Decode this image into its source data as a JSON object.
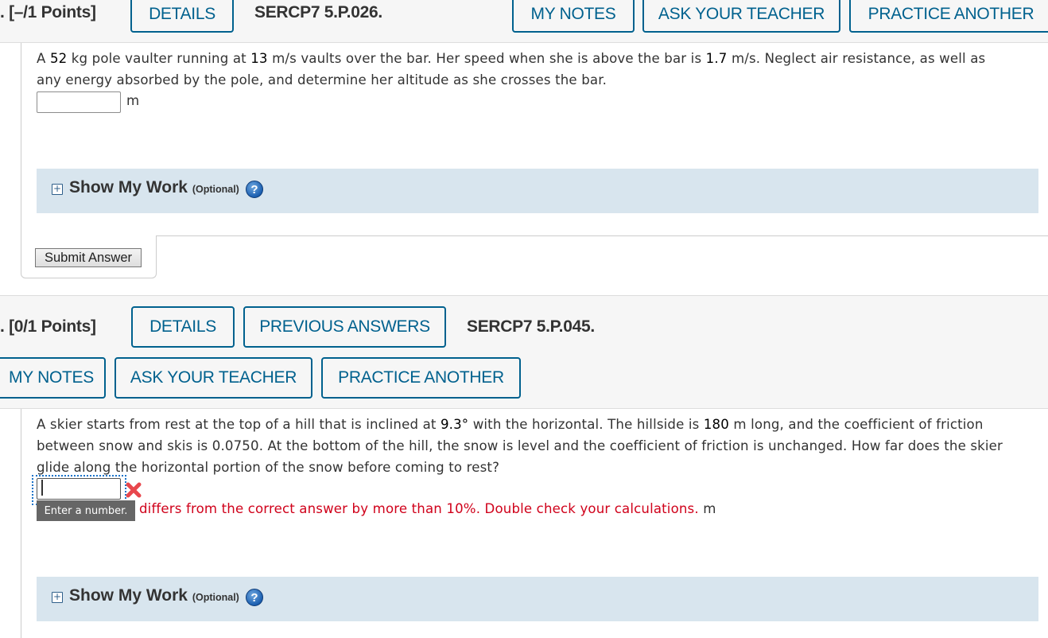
{
  "question1": {
    "points": ". [–/1 Points]",
    "buttons": {
      "details": "DETAILS",
      "my_notes": "MY NOTES",
      "ask_teacher": "ASK YOUR TEACHER",
      "practice_another": "PRACTICE ANOTHER"
    },
    "code": "SERCP7 5.P.026.",
    "text": {
      "p1": "A ",
      "mass": "52",
      "p2": " kg pole vaulter running at ",
      "speed1": "13",
      "p3": " m/s vaults over the bar. Her speed when she is above the bar is ",
      "speed2": "1.7",
      "p4": " m/s. Neglect air resistance, as well as",
      "line2": "any energy absorbed by the pole, and determine her altitude as she crosses the bar."
    },
    "answer_value": "",
    "unit": "m",
    "show_my_work": {
      "title": "Show My Work",
      "optional": "(Optional)",
      "help": "?"
    },
    "submit_label": "Submit Answer"
  },
  "question2": {
    "points": ". [0/1 Points]",
    "buttons": {
      "details": "DETAILS",
      "previous_answers": "PREVIOUS ANSWERS",
      "my_notes": "MY NOTES",
      "ask_teacher": "ASK YOUR TEACHER",
      "practice_another": "PRACTICE ANOTHER"
    },
    "code": "SERCP7 5.P.045.",
    "text": {
      "p1": "A skier starts from rest at the top of a hill that is inclined at ",
      "angle": "9.3°",
      "p2": " with the horizontal. The hillside is ",
      "length": "180",
      "p3": " m long, and the coefficient of friction",
      "line2": "between snow and skis is 0.0750. At the bottom of the hill, the snow is level and the coefficient of friction is unchanged. How far does the skier",
      "line3": "glide along the horizontal portion of the snow before coming to rest?"
    },
    "answer_value": "",
    "tooltip": "Enter a number.",
    "feedback": "differs from the correct answer by more than 10%. Double check your calculations.",
    "unit": "m",
    "show_my_work": {
      "title": "Show My Work",
      "optional": "(Optional)",
      "help": "?"
    }
  },
  "colors": {
    "accent": "#00618e",
    "error": "#d0021b",
    "panel": "#d8e5ee",
    "header_bg": "#f6f6f6"
  }
}
